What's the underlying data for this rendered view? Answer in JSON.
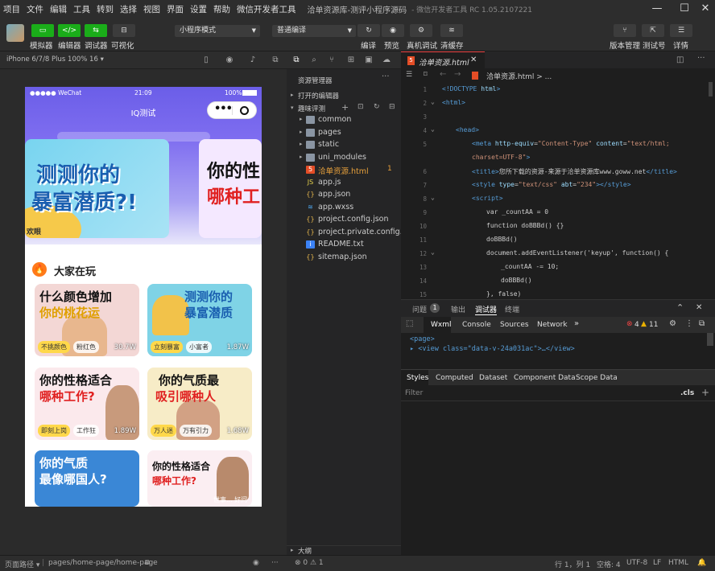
{
  "menu": [
    "项目",
    "文件",
    "编辑",
    "工具",
    "转到",
    "选择",
    "视图",
    "界面",
    "设置",
    "帮助",
    "微信开发者工具"
  ],
  "window_title": "洽单资源库-测评小程序源码",
  "window_version": "- 微信开发者工具 RC 1.05.2107221",
  "toolbar": {
    "simulator": "模拟器",
    "editor": "编辑器",
    "debugger": "调试器",
    "visual": "可视化",
    "mode_select": "小程序模式",
    "compile_select": "普通编译",
    "compile": "编译",
    "preview": "预览",
    "real_debug": "真机调试",
    "clear_cache": "清缓存",
    "version_mgmt": "版本管理",
    "test_id": "测试号",
    "details": "详情"
  },
  "simulator": {
    "device": "iPhone 6/7/8 Plus 100% 16 ▾",
    "status_carrier": "●●●●● WeChat",
    "status_time": "21:09",
    "status_battery": "100%",
    "page_title": "IQ测试",
    "banner1_line1": "测测你的",
    "banner1_line2": "暴富潜质?!",
    "banner1_tag": "欢眼",
    "banner2_line1": "你的性",
    "banner2_line2": "哪种工",
    "section_title": "大家在玩",
    "cards": [
      {
        "l1": "什么颜色增加",
        "l2": "你的桃花运",
        "tag1": "不挑颜色",
        "tag2": "粉红色",
        "count": "30.7W"
      },
      {
        "l1": "测测你的",
        "l2": "暴富潜质",
        "tag1": "立刻暴富",
        "tag2": "小富者",
        "count": "1.87W"
      },
      {
        "l1": "你的性格适合",
        "l2": "哪种工作?",
        "tag1": "即刻上岗",
        "tag2": "工作狂",
        "count": "1.89W"
      },
      {
        "l1": "你的气质最",
        "l2": "吸引哪种人",
        "tag1": "万人迷",
        "tag2": "万有引力",
        "count": "1.68W"
      },
      {
        "l1": "你的气质",
        "l2": "最像哪国人?",
        "tag1": "",
        "tag2": "",
        "count": ""
      },
      {
        "l1": "你的性格适合",
        "l2": "哪种工作?",
        "tag1": "",
        "tag2": "",
        "count": ""
      }
    ],
    "card6_footer": "世事... 好问"
  },
  "explorer": {
    "title": "资源管理器",
    "open_editors": "打开的编辑器",
    "project": "趣味评测",
    "items": [
      {
        "name": "common",
        "type": "folder"
      },
      {
        "name": "pages",
        "type": "folder"
      },
      {
        "name": "static",
        "type": "folder"
      },
      {
        "name": "uni_modules",
        "type": "folder"
      },
      {
        "name": "洽单资源.html",
        "type": "html",
        "badge": "1"
      },
      {
        "name": "app.js",
        "type": "js"
      },
      {
        "name": "app.json",
        "type": "json"
      },
      {
        "name": "app.wxss",
        "type": "wxss"
      },
      {
        "name": "project.config.json",
        "type": "json"
      },
      {
        "name": "project.private.config.js...",
        "type": "json"
      },
      {
        "name": "README.txt",
        "type": "txt"
      },
      {
        "name": "sitemap.json",
        "type": "json"
      }
    ],
    "outline": "大纲"
  },
  "editor": {
    "tab": "洽单资源.html",
    "breadcrumb": "洽单资源.html > ...",
    "line_numbers": [
      "1",
      "2",
      "3",
      "4",
      "5",
      "",
      "6",
      "7",
      "8",
      "9",
      "10",
      "11",
      "12",
      "13",
      "14",
      "15"
    ]
  },
  "panel": {
    "tabs": [
      "问题",
      "输出",
      "调试器",
      "终端"
    ],
    "problem_count": "1",
    "devtools_tabs": [
      "Wxml",
      "Console",
      "Sources",
      "Network"
    ],
    "errors": "4",
    "warnings": "11",
    "wxml_line1": "<page>",
    "wxml_line2": "▸ <view class=\"data-v-24a031ac\">…</view>",
    "style_tabs": [
      "Styles",
      "Computed",
      "Dataset",
      "Component Data",
      "Scope Data"
    ],
    "filter": "Filter",
    "cls": ".cls"
  },
  "status": {
    "page_path_label": "页面路径 ▾",
    "page_path": "pages/home-page/home-page",
    "problems": "⊗ 0 ⚠ 1",
    "cursor": "行 1，列 1",
    "spaces": "空格: 4",
    "encoding": "UTF-8",
    "eol": "LF",
    "lang": "HTML"
  },
  "colors": {
    "accent_green": "#1aad19",
    "brand_purple": "#7e6df0",
    "html_orange": "#e44d26"
  }
}
